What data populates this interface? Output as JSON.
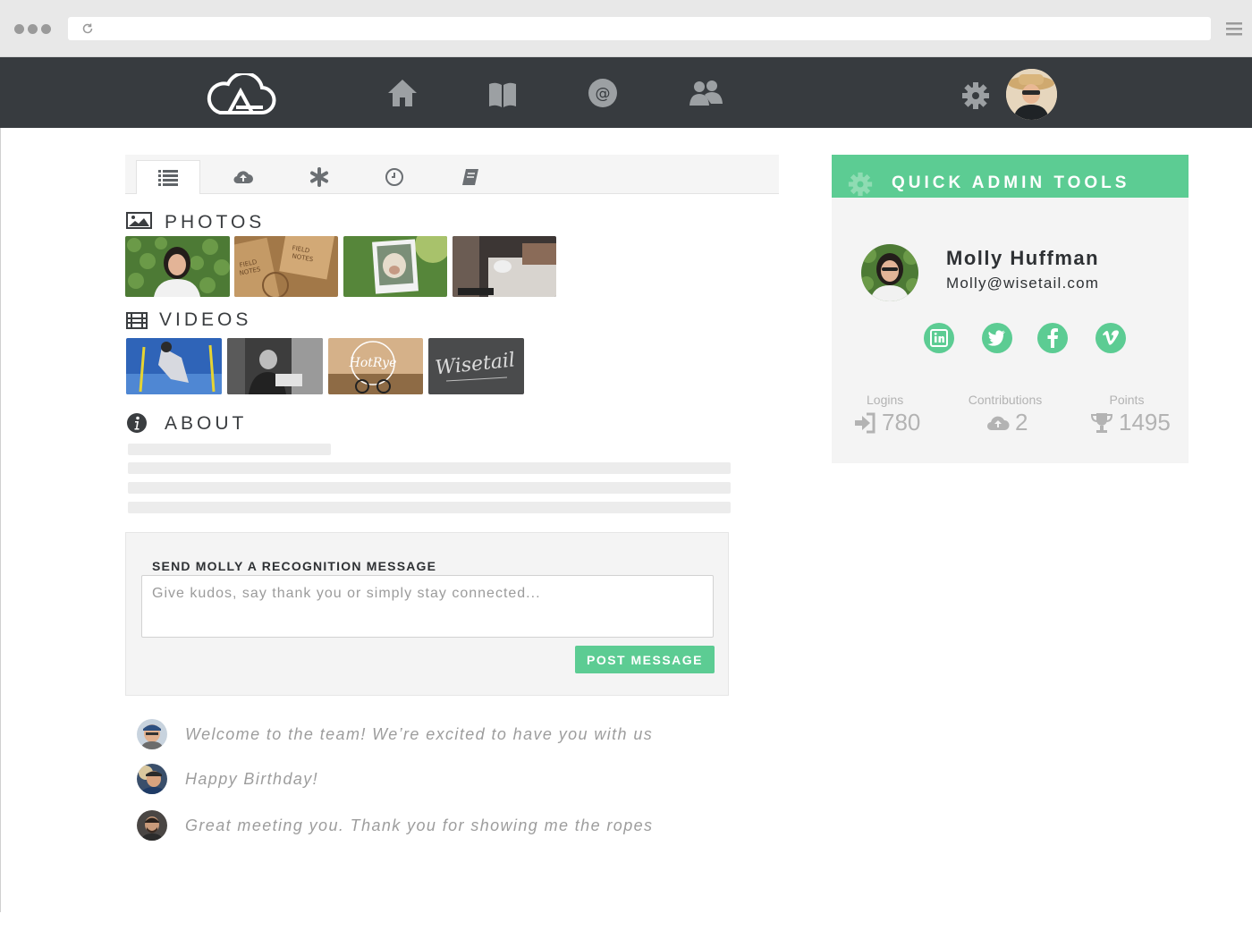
{
  "browser": {
    "url": ""
  },
  "header": {
    "nav": [
      "home",
      "library",
      "mentions",
      "people"
    ],
    "accent_color": "#5ccc93",
    "bar_color": "#373b3f"
  },
  "tabs": [
    {
      "icon": "list-icon",
      "active": true
    },
    {
      "icon": "cloud-upload-icon",
      "active": false
    },
    {
      "icon": "asterisk-icon",
      "active": false
    },
    {
      "icon": "clock-icon",
      "active": false
    },
    {
      "icon": "notebook-icon",
      "active": false
    }
  ],
  "sections": {
    "photos": "PHOTOS",
    "videos": "VIDEOS",
    "about": "ABOUT"
  },
  "recognition": {
    "label": "SEND MOLLY A RECOGNITION MESSAGE",
    "placeholder": "Give kudos, say thank you or simply stay connected...",
    "button": "POST MESSAGE"
  },
  "messages": [
    {
      "text": "Welcome to the team! We’re excited to have you with us"
    },
    {
      "text": "Happy Birthday!"
    },
    {
      "text": "Great meeting you. Thank you for showing me the ropes"
    }
  ],
  "admin": {
    "title": "QUICK ADMIN TOOLS",
    "name": "Molly Huffman",
    "email": "Molly@wisetail.com",
    "social": [
      "in",
      "t",
      "f",
      "v"
    ],
    "stats": [
      {
        "label": "Logins",
        "value": "780"
      },
      {
        "label": "Contributions",
        "value": "2"
      },
      {
        "label": "Points",
        "value": "1495"
      }
    ]
  },
  "video_thumbs": {
    "wisetail": "Wisetail"
  }
}
